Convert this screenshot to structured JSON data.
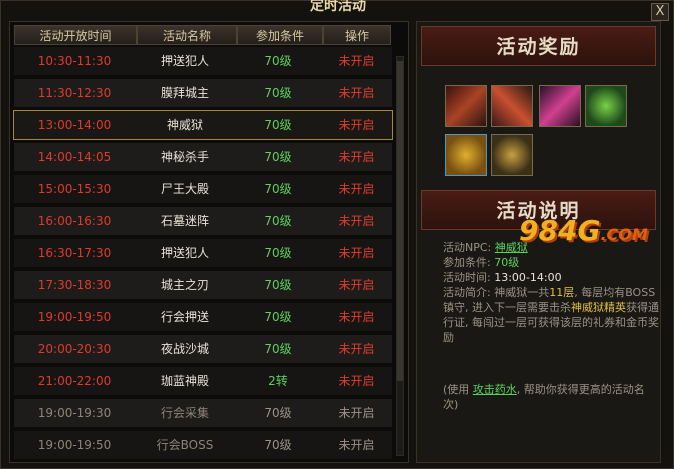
{
  "window": {
    "title": "定时活动",
    "close_label": "X"
  },
  "table": {
    "headers": [
      "活动开放时间",
      "活动名称",
      "参加条件",
      "操作"
    ],
    "rows": [
      {
        "time": "10:30-11:30",
        "name": "押送犯人",
        "level": "70级",
        "status": "未开启",
        "time_color": "red",
        "name_color": "white",
        "level_color": "green",
        "status_color": "red",
        "selected": false
      },
      {
        "time": "11:30-12:30",
        "name": "膜拜城主",
        "level": "70级",
        "status": "未开启",
        "time_color": "red",
        "name_color": "white",
        "level_color": "green",
        "status_color": "red",
        "selected": false
      },
      {
        "time": "13:00-14:00",
        "name": "神威狱",
        "level": "70级",
        "status": "未开启",
        "time_color": "red",
        "name_color": "white",
        "level_color": "green",
        "status_color": "red",
        "selected": true
      },
      {
        "time": "14:00-14:05",
        "name": "神秘杀手",
        "level": "70级",
        "status": "未开启",
        "time_color": "red",
        "name_color": "white",
        "level_color": "green",
        "status_color": "red",
        "selected": false
      },
      {
        "time": "15:00-15:30",
        "name": "尸王大殿",
        "level": "70级",
        "status": "未开启",
        "time_color": "red",
        "name_color": "white",
        "level_color": "green",
        "status_color": "red",
        "selected": false
      },
      {
        "time": "16:00-16:30",
        "name": "石墓迷阵",
        "level": "70级",
        "status": "未开启",
        "time_color": "red",
        "name_color": "white",
        "level_color": "green",
        "status_color": "red",
        "selected": false
      },
      {
        "time": "16:30-17:30",
        "name": "押送犯人",
        "level": "70级",
        "status": "未开启",
        "time_color": "red",
        "name_color": "white",
        "level_color": "green",
        "status_color": "red",
        "selected": false
      },
      {
        "time": "17:30-18:30",
        "name": "城主之刃",
        "level": "70级",
        "status": "未开启",
        "time_color": "red",
        "name_color": "white",
        "level_color": "green",
        "status_color": "red",
        "selected": false
      },
      {
        "time": "19:00-19:50",
        "name": "行会押送",
        "level": "70级",
        "status": "未开启",
        "time_color": "red",
        "name_color": "white",
        "level_color": "green",
        "status_color": "red",
        "selected": false
      },
      {
        "time": "20:00-20:30",
        "name": "夜战沙城",
        "level": "70级",
        "status": "未开启",
        "time_color": "red",
        "name_color": "white",
        "level_color": "green",
        "status_color": "red",
        "selected": false
      },
      {
        "time": "21:00-22:00",
        "name": "珈蓝神殿",
        "level": "2转",
        "status": "未开启",
        "time_color": "red",
        "name_color": "white",
        "level_color": "green",
        "status_color": "red",
        "selected": false
      },
      {
        "time": "19:00-19:30",
        "name": "行会采集",
        "level": "70级",
        "status": "未开启",
        "time_color": "grey",
        "name_color": "grey",
        "level_color": "grey",
        "status_color": "grey",
        "selected": false
      },
      {
        "time": "19:00-19:50",
        "name": "行会BOSS",
        "level": "70级",
        "status": "未开启",
        "time_color": "grey",
        "name_color": "grey",
        "level_color": "grey",
        "status_color": "grey",
        "selected": false
      }
    ]
  },
  "rewards": {
    "title": "活动奖励",
    "items": [
      "sword-icon",
      "staff-icon",
      "wand-icon",
      "green-badge-icon",
      "scroll-icon",
      "gold-coins-icon"
    ]
  },
  "description": {
    "title": "活动说明",
    "npc_label": "活动NPC:",
    "npc_value": "神威狱",
    "condition_label": "参加条件:",
    "condition_value": "70级",
    "time_label": "活动时间:",
    "time_value": "13:00-14:00",
    "intro_part1": "活动简介: 神威狱一共",
    "intro_floors": "11层",
    "intro_part2": ", 每层均有BOSS镇守, 进入下一层需要击杀",
    "intro_elite": "神威狱精英",
    "intro_part3": "获得通行证, 每闯过一层可获得该层的礼券和金币奖励",
    "hint_part1": "(使用",
    "hint_link": "攻击药水",
    "hint_part2": ", 帮助你获得更高的活动名次)"
  },
  "watermark": {
    "text": "984G",
    "suffix": ".COM"
  },
  "colors": {
    "red": "#e03a2a",
    "green": "#5bd25b",
    "grey": "#8c8478",
    "white": "#e6e2d6",
    "gold": "#a8883a"
  }
}
